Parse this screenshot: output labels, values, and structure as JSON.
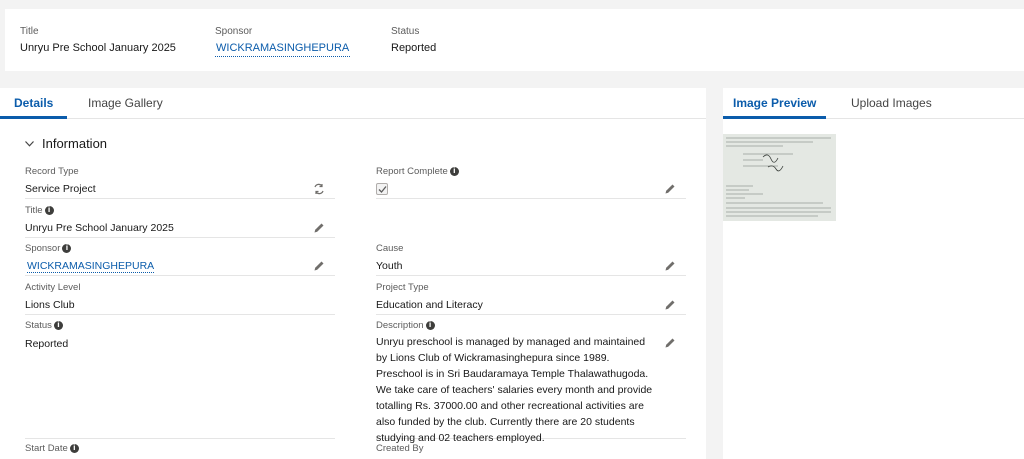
{
  "highlights": {
    "title_label": "Title",
    "title_value": "Unryu Pre School January 2025",
    "sponsor_label": "Sponsor",
    "sponsor_value": "WICKRAMASINGHEPURA",
    "status_label": "Status",
    "status_value": "Reported"
  },
  "main_tabs": [
    {
      "label": "Details",
      "active": true
    },
    {
      "label": "Image Gallery",
      "active": false
    }
  ],
  "section": {
    "title": "Information"
  },
  "fields": {
    "record_type": {
      "label": "Record Type",
      "value": "Service Project"
    },
    "report_complete": {
      "label": "Report Complete",
      "checked": true
    },
    "title": {
      "label": "Title",
      "value": "Unryu Pre School January 2025"
    },
    "sponsor": {
      "label": "Sponsor",
      "value": "WICKRAMASINGHEPURA"
    },
    "cause": {
      "label": "Cause",
      "value": "Youth"
    },
    "activity_level": {
      "label": "Activity Level",
      "value": "Lions Club"
    },
    "project_type": {
      "label": "Project Type",
      "value": "Education and Literacy"
    },
    "status": {
      "label": "Status",
      "value": "Reported"
    },
    "description": {
      "label": "Description",
      "value": "Unryu preschool is managed by managed and maintained by Lions Club of Wickramasinghepura since 1989. Preschool is in Sri Baudaramaya Temple Thalawathugoda. We take care of teachers' salaries every month and provide totalling Rs. 37000.00 and other recreational activities are also funded by the club. Currently there are 20 students studying and 02 teachers employed."
    },
    "start_date": {
      "label": "Start Date"
    },
    "created_by": {
      "label": "Created By"
    }
  },
  "side_tabs": [
    {
      "label": "Image Preview",
      "active": true
    },
    {
      "label": "Upload Images",
      "active": false
    }
  ],
  "icons": {
    "info": "info-icon",
    "edit": "pencil-icon",
    "record_type_change": "change-record-type-icon",
    "collapse": "chevron-down-icon"
  },
  "colors": {
    "link": "#0b5cab",
    "active_tab": "#0b5cab",
    "background": "#f3f3f3"
  }
}
